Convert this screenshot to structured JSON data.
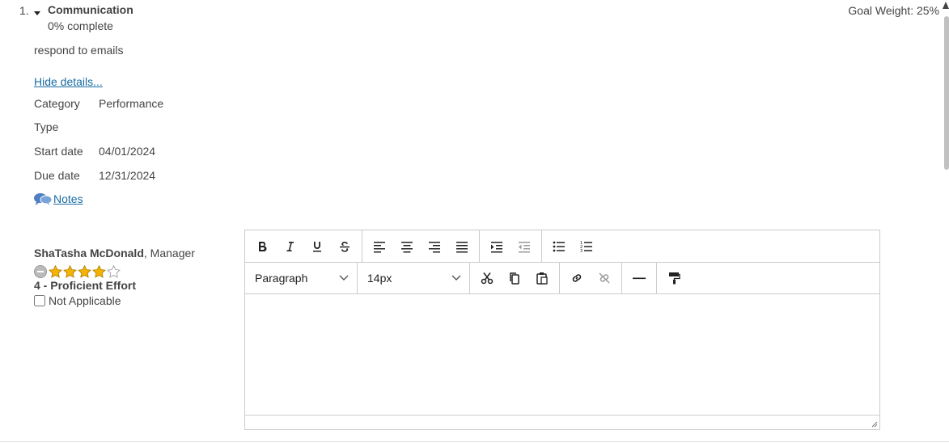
{
  "goal": {
    "number": "1.",
    "title": "Communication",
    "progress": "0% complete",
    "weight": "Goal Weight: 25%",
    "description": "respond to emails",
    "hide_details": "Hide details...",
    "details": [
      {
        "label": "Category",
        "value": "Performance"
      },
      {
        "label": "Type",
        "value": ""
      },
      {
        "label": "Start date",
        "value": "04/01/2024"
      },
      {
        "label": "Due date",
        "value": "12/31/2024"
      }
    ],
    "notes": "Notes"
  },
  "review": {
    "reviewer_name": "ShaTasha McDonald",
    "reviewer_role": ", Manager",
    "rating": 4,
    "rating_max": 5,
    "rating_label": "4 - Proficient Effort",
    "not_applicable": "Not Applicable"
  },
  "editor": {
    "block_format": "Paragraph",
    "font_size": "14px",
    "toolbar_icons": [
      "bold-icon",
      "italic-icon",
      "underline-icon",
      "strikethrough-icon",
      "align-left-icon",
      "align-center-icon",
      "align-right-icon",
      "align-justify-icon",
      "indent-icon",
      "outdent-icon",
      "bullet-list-icon",
      "numbered-list-icon",
      "cut-icon",
      "copy-icon",
      "paste-icon",
      "link-icon",
      "unlink-icon",
      "horizontal-rule-icon",
      "format-painter-icon"
    ]
  },
  "colors": {
    "link": "#1a6ba3",
    "star": "#f5b301",
    "text": "#444444"
  }
}
